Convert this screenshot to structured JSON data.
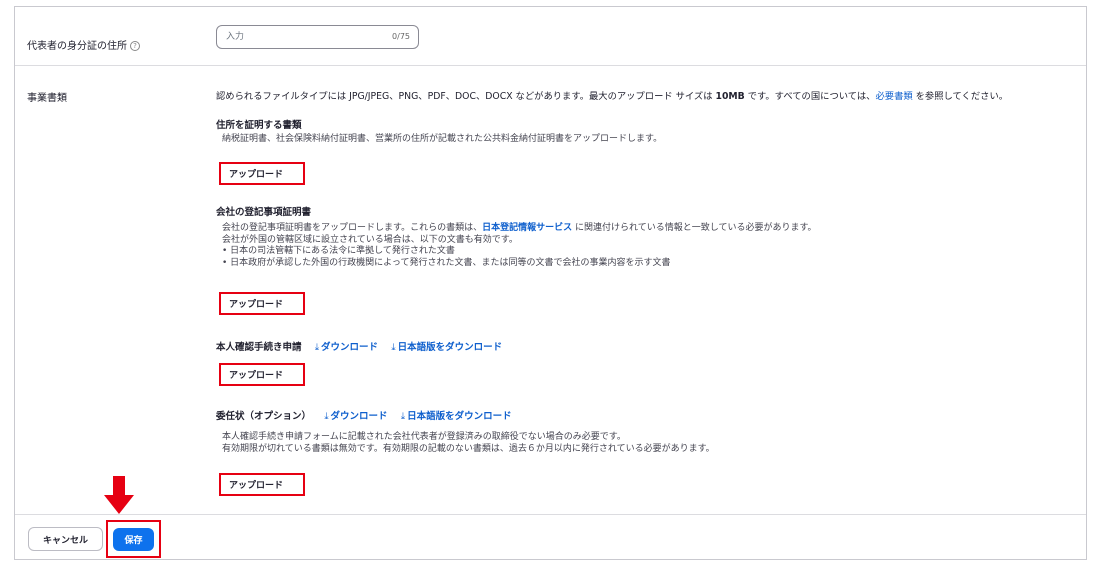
{
  "address_row": {
    "label": "代表者の身分証の住所",
    "help_glyph": "?",
    "input_placeholder": "入力",
    "input_value": "",
    "counter": "0/75"
  },
  "documents": {
    "label": "事業書類",
    "intro_prefix": "認められるファイルタイプには JPG/JPEG、PNG、PDF、DOC、DOCX などがあります。最大のアップロード サイズは ",
    "intro_size": "10MB",
    "intro_middle": " です。すべての国については、",
    "intro_link": "必要書類",
    "intro_suffix": " を参照してください。",
    "sections": [
      {
        "title": "住所を証明する書類",
        "lines": [
          "納税証明書、社会保険料納付証明書、営業所の住所が記載された公共料金納付証明書をアップロードします。"
        ],
        "upload_label": "アップロード"
      },
      {
        "title": "会社の登記事項証明書",
        "line1_prefix": "会社の登記事項証明書をアップロードします。これらの書類は、",
        "line1_link": "日本登記情報サービス",
        "line1_suffix": " に関連付けられている情報と一致している必要があります。",
        "lines": [
          "会社が外国の管轄区域に設立されている場合は、以下の文書も有効です。",
          "• 日本の司法管轄下にある法令に準拠して発行された文書",
          "• 日本政府が承認した外国の行政機関によって発行された文書、または同等の文書で会社の事業内容を示す文書"
        ],
        "upload_label": "アップロード"
      },
      {
        "title": "本人確認手続き申請",
        "download_label": "ダウンロード",
        "download_jp_label": "日本語版をダウンロード",
        "upload_label": "アップロード"
      },
      {
        "title": "委任状（オプション）",
        "download_label": "ダウンロード",
        "download_jp_label": "日本語版をダウンロード",
        "lines": [
          "本人確認手続き申請フォームに記載された会社代表者が登録済みの取締役でない場合のみ必要です。",
          "有効期限が切れている書類は無効です。有効期限の記載のない書類は、過去６か月以内に発行されている必要があります。"
        ],
        "upload_label": "アップロード"
      }
    ]
  },
  "footer": {
    "cancel_label": "キャンセル",
    "save_label": "保存"
  },
  "colors": {
    "highlight": "#e60012",
    "link": "#0e5fcd",
    "primary": "#0e72ed"
  },
  "icons": {
    "download": "download-icon",
    "help": "help-icon",
    "arrow": "down-arrow-annotation-icon"
  }
}
